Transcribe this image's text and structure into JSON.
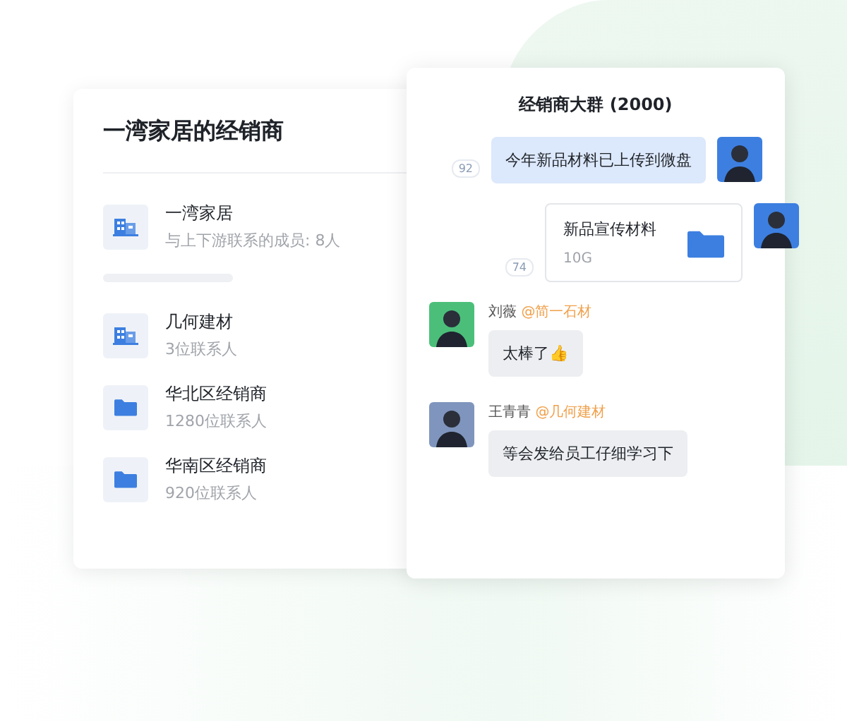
{
  "dealers_panel": {
    "title": "一湾家居的经销商",
    "items": [
      {
        "kind": "company",
        "name": "一湾家居",
        "detail": "与上下游联系的成员: 8人"
      },
      {
        "kind": "company",
        "name": "几何建材",
        "detail": "3位联系人"
      },
      {
        "kind": "folder",
        "name": "华北区经销商",
        "detail": "1280位联系人"
      },
      {
        "kind": "folder",
        "name": "华南区经销商",
        "detail": "920位联系人"
      }
    ]
  },
  "group_chat": {
    "title": "经销商大群 (2000)",
    "messages": [
      {
        "kind": "outgoing-text",
        "text": "今年新品材料已上传到微盘",
        "read_count": "92",
        "color": "#3d7fe0"
      },
      {
        "kind": "outgoing-file",
        "file_name": "新品宣传材料",
        "file_size": "10G",
        "read_count": "74",
        "color": "#3d7fe0"
      },
      {
        "kind": "incoming-text",
        "sender": "刘薇",
        "org": "@简一石材",
        "text": "太棒了👍",
        "color": "#4bbf7a"
      },
      {
        "kind": "incoming-text",
        "sender": "王青青",
        "org": "@几何建材",
        "text": "等会发给员工仔细学习下",
        "color": "#7f95bd"
      }
    ]
  }
}
